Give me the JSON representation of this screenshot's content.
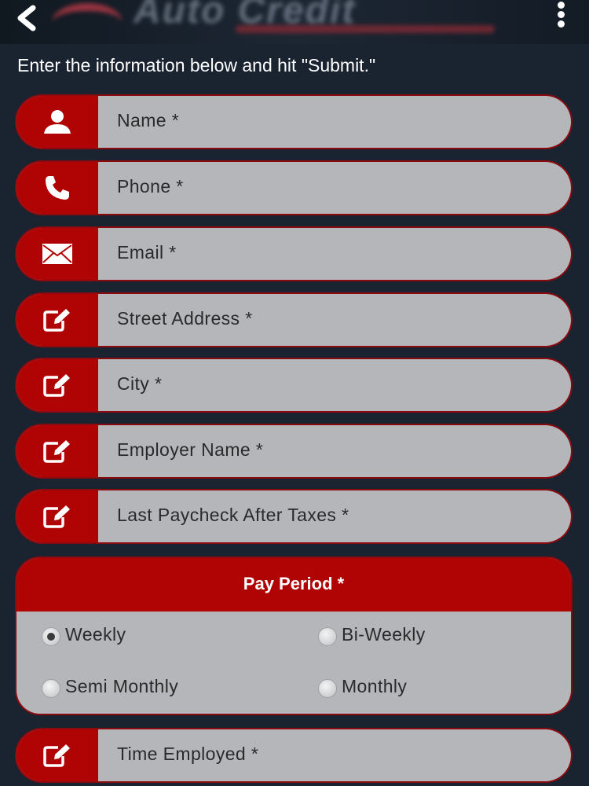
{
  "header": {
    "back_label": "‹",
    "back_icon": "chevron-left-icon",
    "logo_text": "Auto Credit",
    "menu_icon": "more-vertical-icon"
  },
  "intro_text": "Enter the information below and hit \"Submit.\"",
  "fields": [
    {
      "label": "Name *",
      "icon": "user-icon"
    },
    {
      "label": "Phone *",
      "icon": "phone-icon"
    },
    {
      "label": "Email *",
      "icon": "envelope-icon"
    },
    {
      "label": "Street Address *",
      "icon": "edit-icon"
    },
    {
      "label": "City *",
      "icon": "edit-icon"
    },
    {
      "label": "Employer Name *",
      "icon": "edit-icon"
    },
    {
      "label": "Last Paycheck After Taxes *",
      "icon": "edit-icon"
    },
    {
      "label": "Time Employed *",
      "icon": "edit-icon"
    }
  ],
  "pay_period": {
    "title": "Pay Period *",
    "options": [
      {
        "label": "Weekly",
        "selected": true
      },
      {
        "label": "Bi-Weekly",
        "selected": false
      },
      {
        "label": "Semi Monthly",
        "selected": false
      },
      {
        "label": "Monthly",
        "selected": false
      }
    ]
  },
  "colors": {
    "background": "#1a2330",
    "accent_red": "#b00404",
    "field_gray": "#b4b6ba"
  }
}
